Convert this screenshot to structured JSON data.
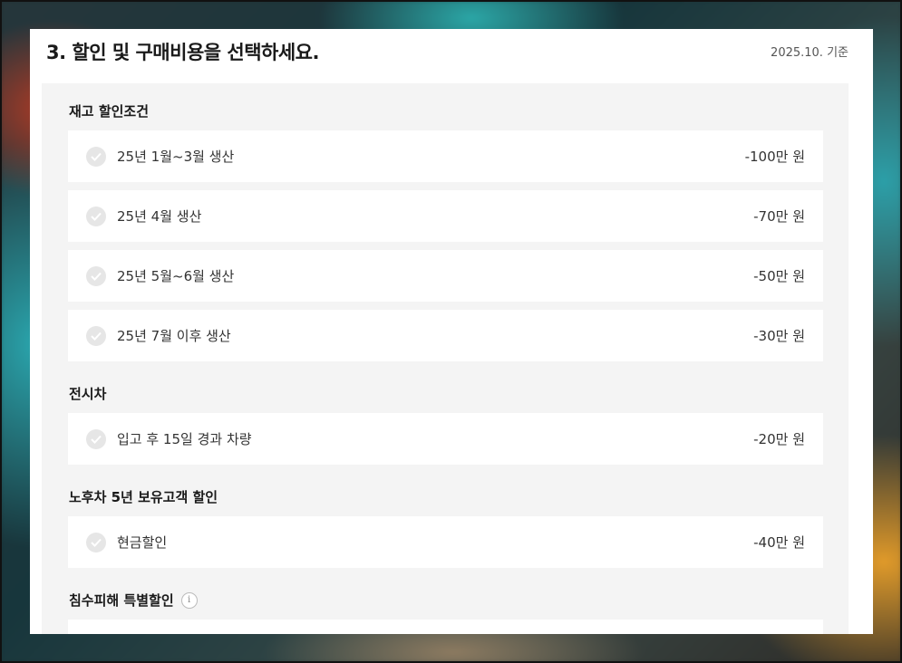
{
  "header": {
    "title": "3. 할인 및 구매비용을 선택하세요.",
    "date": "2025.10. 기준"
  },
  "sections": [
    {
      "label": "재고 할인조건",
      "items": [
        {
          "label": "25년 1월~3월 생산",
          "amount": "-100만 원"
        },
        {
          "label": "25년 4월 생산",
          "amount": "-70만 원"
        },
        {
          "label": "25년 5월~6월 생산",
          "amount": "-50만 원"
        },
        {
          "label": "25년 7월 이후 생산",
          "amount": "-30만 원"
        }
      ]
    },
    {
      "label": "전시차",
      "items": [
        {
          "label": "입고 후 15일 경과 차량",
          "amount": "-20만 원"
        }
      ]
    },
    {
      "label": "노후차 5년 보유고객 할인",
      "items": [
        {
          "label": "현금할인",
          "amount": "-40만 원"
        }
      ]
    },
    {
      "label": "침수피해 특별할인",
      "info_icon": "info-icon",
      "items": []
    }
  ],
  "colors": {
    "panel_bg": "#ffffff",
    "inner_bg": "#f4f4f4",
    "check_bg": "#e6e6e6"
  }
}
